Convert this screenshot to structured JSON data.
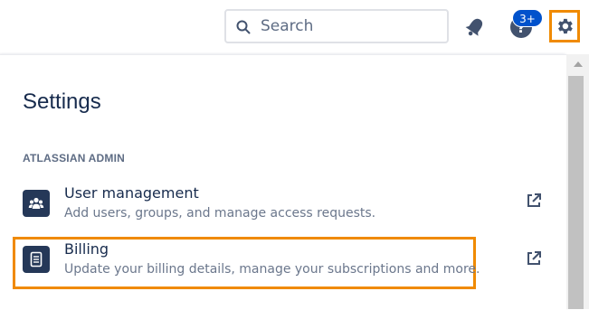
{
  "topbar": {
    "search_placeholder": "Search",
    "help_badge": "3+"
  },
  "panel": {
    "title": "Settings",
    "section_header": "ATLASSIAN ADMIN",
    "items": [
      {
        "title": "User management",
        "description": "Add users, groups, and manage access requests.",
        "icon": "users-icon"
      },
      {
        "title": "Billing",
        "description": "Update your billing details, manage your subscriptions and more.",
        "icon": "document-icon"
      }
    ]
  },
  "colors": {
    "accent": "#0052cc",
    "highlight": "#f08a00",
    "text_primary": "#172b4d",
    "text_secondary": "#6b778c"
  }
}
